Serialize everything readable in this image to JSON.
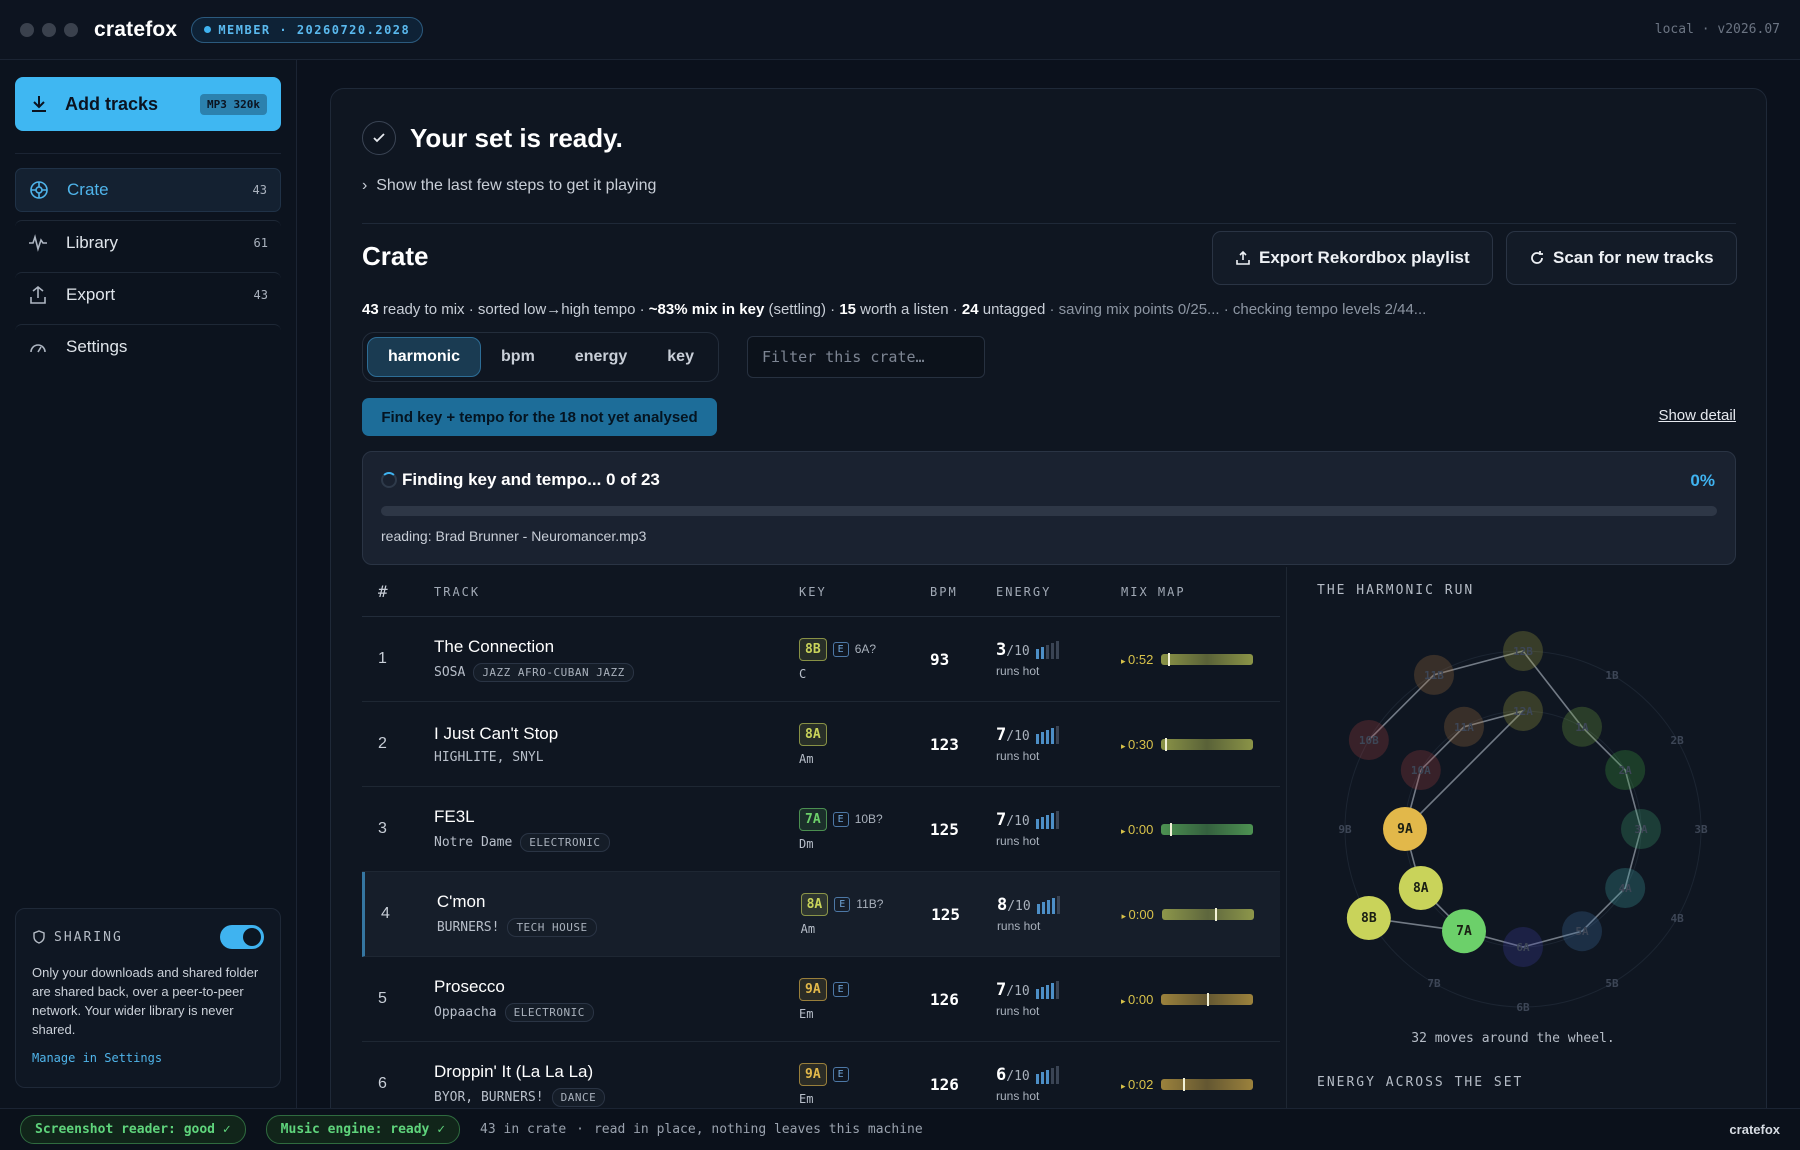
{
  "titlebar": {
    "brand": "cratefox",
    "member_badge": "MEMBER · 20260720.2028",
    "version": "local · v2026.07"
  },
  "sidebar": {
    "add_tracks": {
      "label": "Add tracks",
      "format": "MP3 320k"
    },
    "items": [
      {
        "label": "Crate",
        "count": "43",
        "icon": "target-icon"
      },
      {
        "label": "Library",
        "count": "61",
        "icon": "waveform-icon"
      },
      {
        "label": "Export",
        "count": "43",
        "icon": "upload-icon"
      },
      {
        "label": "Settings",
        "count": "",
        "icon": "gauge-icon"
      }
    ],
    "sharing": {
      "title": "SHARING",
      "enabled": true,
      "text": "Only your downloads and shared folder are shared back, over a peer-to-peer network. Your wider library is never shared.",
      "link": "Manage in Settings"
    }
  },
  "main": {
    "ready_title": "Your set is ready.",
    "steps_toggle": "Show the last few steps to get it playing",
    "crate_title": "Crate",
    "export_button": "Export Rekordbox playlist",
    "scan_button": "Scan for new tracks",
    "summary": {
      "ready": "43",
      "ready_text": " ready to mix · sorted low→high tempo · ",
      "mix_in_key": "~83% mix in key",
      "mix_text": " (settling) · ",
      "worth": "15",
      "worth_text": " worth a listen · ",
      "untagged": "24",
      "untagged_text": " untagged",
      "dim": " · saving mix points 0/25... · checking tempo levels 2/44..."
    },
    "sort_tabs": [
      "harmonic",
      "bpm",
      "energy",
      "key"
    ],
    "active_tab": "harmonic",
    "filter_placeholder": "Filter this crate…",
    "find_button": "Find key + tempo for the 18 not yet analysed",
    "show_detail": "Show detail",
    "progress": {
      "title": "Finding key and tempo... 0 of 23",
      "percent": "0%",
      "value": 0,
      "reading": "reading: Brad Brunner - Neuromancer.mp3"
    }
  },
  "table": {
    "headers": {
      "num": "#",
      "track": "TRACK",
      "key": "KEY",
      "bpm": "BPM",
      "energy": "ENERGY",
      "mix": "MIX MAP"
    },
    "rows": [
      {
        "num": "1",
        "title": "The Connection",
        "artist": "SOSA",
        "tag": "JAZZ AFRO-CUBAN JAZZ",
        "key": "8B",
        "key_color": "#c9d35a",
        "e": true,
        "alt": "6A?",
        "key_name": "C",
        "bpm": "93",
        "energy": "3",
        "of": "/10",
        "hot": "runs hot",
        "mix": "0:52",
        "mix_pos": 0.08
      },
      {
        "num": "2",
        "title": "I Just Can't Stop",
        "artist": "HIGHLITE, SNYL",
        "tag": "",
        "key": "8A",
        "key_color": "#c9d35a",
        "e": false,
        "alt": "",
        "key_name": "Am",
        "bpm": "123",
        "energy": "7",
        "of": "/10",
        "hot": "runs hot",
        "mix": "0:30",
        "mix_pos": 0.05
      },
      {
        "num": "3",
        "title": "FE3L",
        "artist": "Notre Dame",
        "tag": "ELECTRONIC",
        "key": "7A",
        "key_color": "#6cd06a",
        "e": true,
        "alt": "10B?",
        "key_name": "Dm",
        "bpm": "125",
        "energy": "7",
        "of": "/10",
        "hot": "runs hot",
        "mix": "0:00",
        "mix_pos": 0.1
      },
      {
        "num": "4",
        "title": "C'mon",
        "artist": "BURNERS!",
        "tag": "TECH HOUSE",
        "key": "8A",
        "key_color": "#c9d35a",
        "e": true,
        "alt": "11B?",
        "key_name": "Am",
        "bpm": "125",
        "energy": "8",
        "of": "/10",
        "hot": "runs hot",
        "mix": "0:00",
        "mix_pos": 0.6
      },
      {
        "num": "5",
        "title": "Prosecco",
        "artist": "Oppaacha",
        "tag": "ELECTRONIC",
        "key": "9A",
        "key_color": "#e2b84a",
        "e": true,
        "alt": "",
        "key_name": "Em",
        "bpm": "126",
        "energy": "7",
        "of": "/10",
        "hot": "runs hot",
        "mix": "0:00",
        "mix_pos": 0.52
      },
      {
        "num": "6",
        "title": "Droppin' It (La La La)",
        "artist": "BYOR, BURNERS!",
        "tag": "DANCE",
        "key": "9A",
        "key_color": "#e2b84a",
        "e": true,
        "alt": "",
        "key_name": "Em",
        "bpm": "126",
        "energy": "6",
        "of": "/10",
        "hot": "runs hot",
        "mix": "0:02",
        "mix_pos": 0.25
      }
    ]
  },
  "panel": {
    "title": "THE HARMONIC RUN",
    "moves": "32 moves around the wheel.",
    "energy_title": "ENERGY ACROSS THE SET",
    "wheel_labels": [
      "1B",
      "2B",
      "3B",
      "4B",
      "5B",
      "6B",
      "7B",
      "8B",
      "9B",
      "10B",
      "11B",
      "12B",
      "1A",
      "2A",
      "3A",
      "4A",
      "5A",
      "6A",
      "7A",
      "8A",
      "9A",
      "10A",
      "11A",
      "12A"
    ],
    "highlight": [
      "9A",
      "8A",
      "7A",
      "8B"
    ]
  },
  "statusbar": {
    "reader": "Screenshot reader: good ✓",
    "engine": "Music engine: ready ✓",
    "count": "43 in crate",
    "note": "read in place, nothing leaves this machine",
    "brand": "cratefox"
  },
  "colors": {
    "accent": "#3fb7f2",
    "good": "#5fd47c",
    "key_8": "#c9d35a",
    "key_7": "#6cd06a",
    "key_9": "#e2b84a"
  }
}
